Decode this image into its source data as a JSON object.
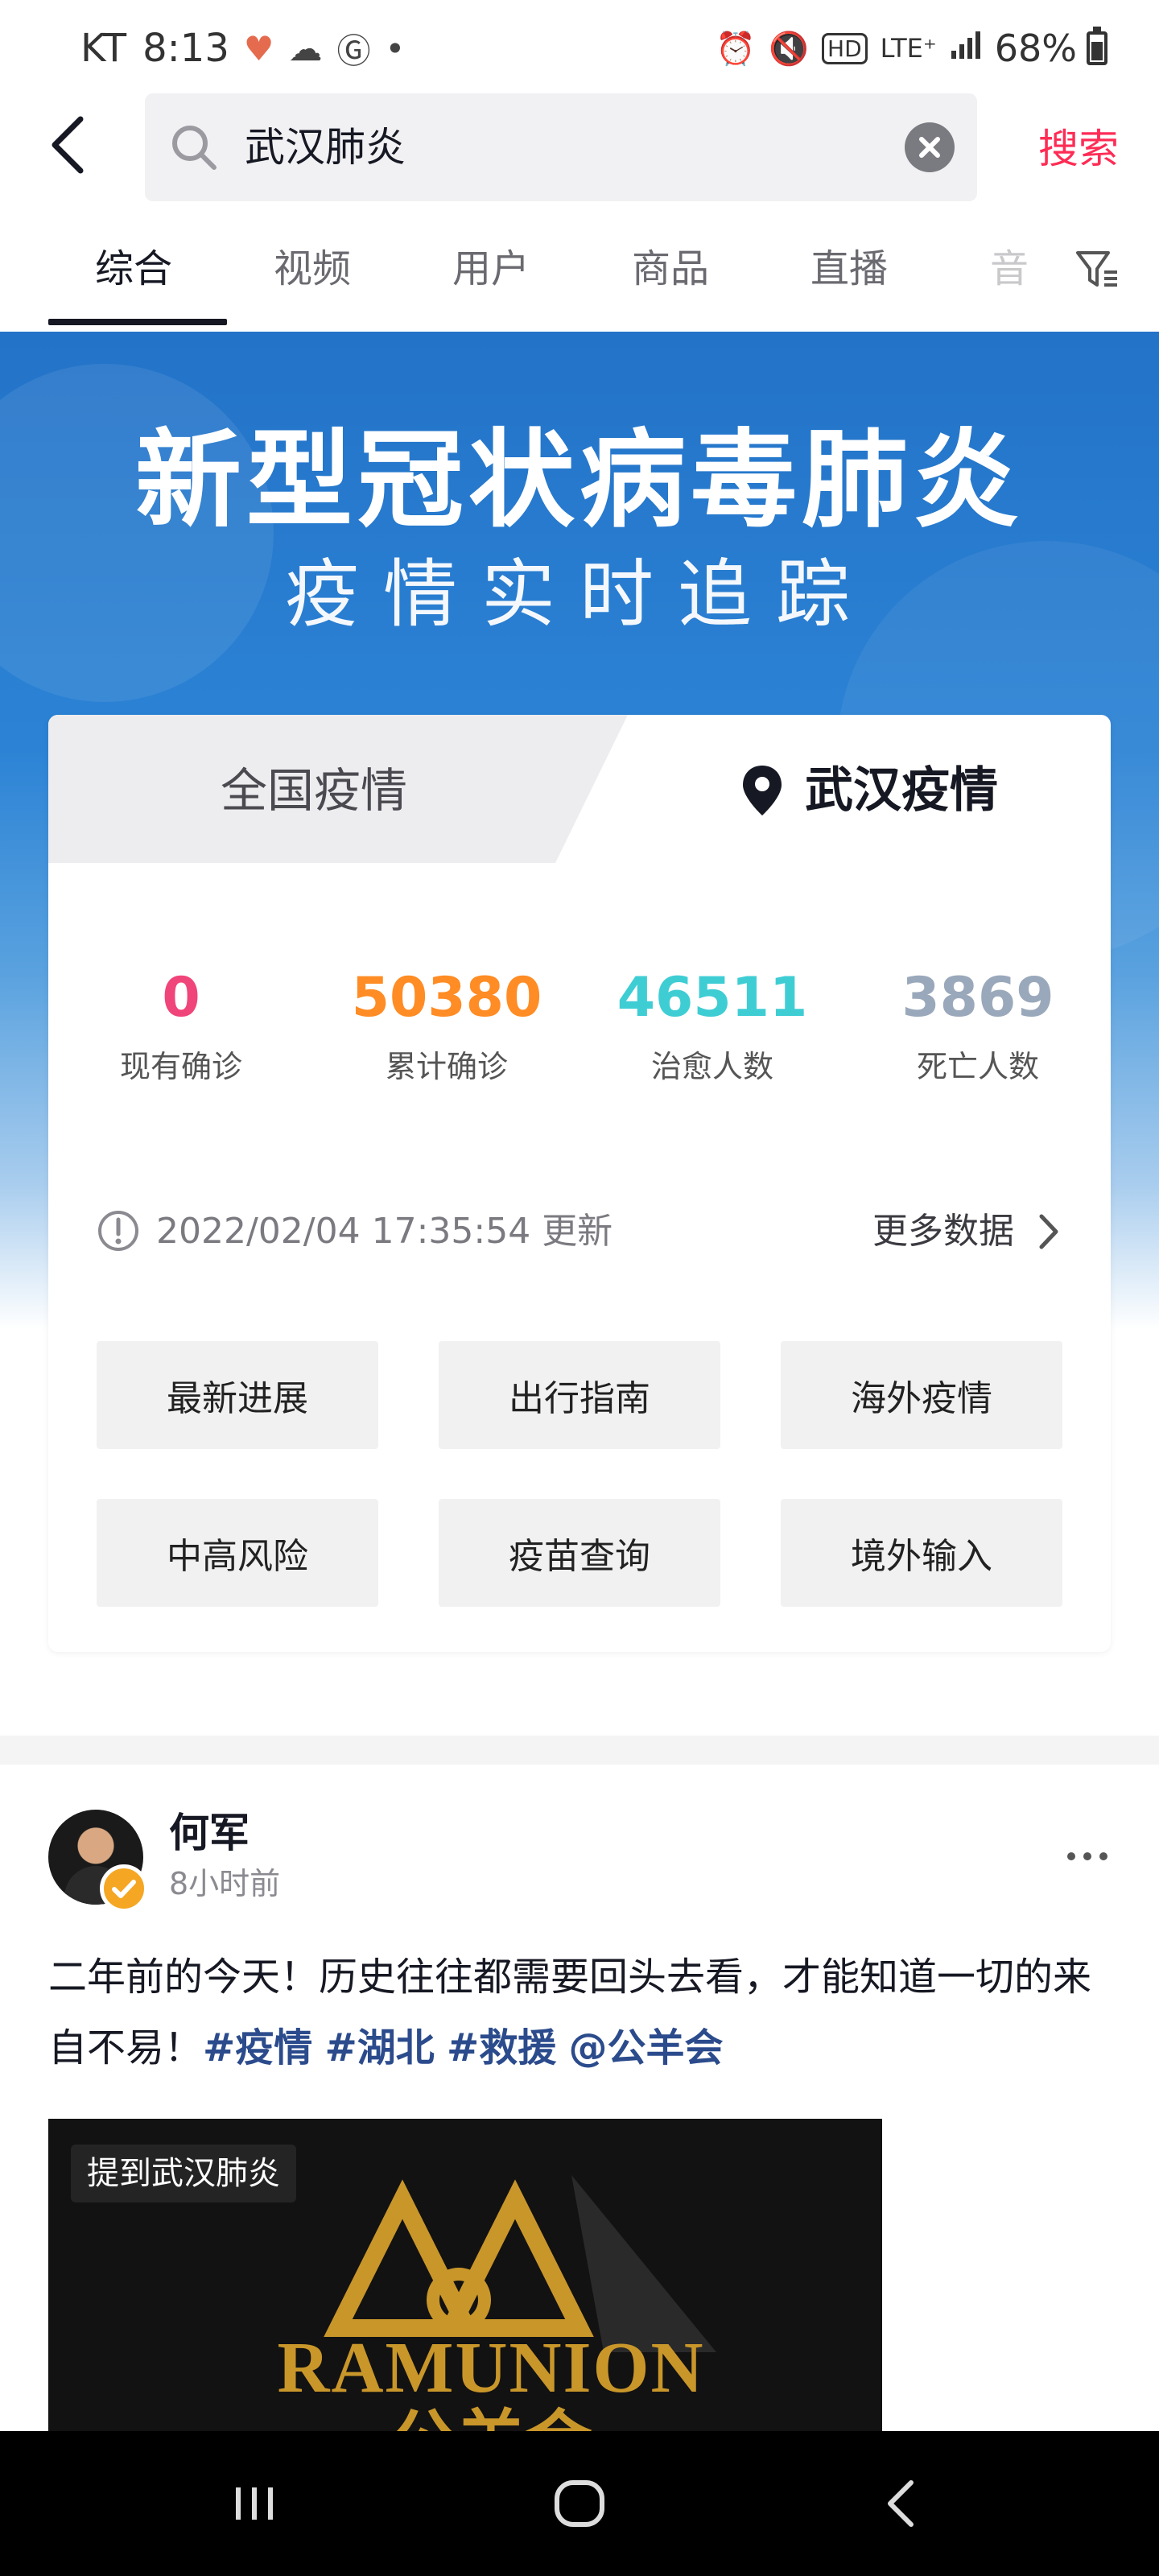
{
  "status_bar": {
    "carrier": "KT",
    "time": "8:13",
    "left_icons": [
      "heart-pulse-icon",
      "cloud-icon",
      "g-icon",
      "dot-icon"
    ],
    "right_icons": [
      "alarm-icon",
      "mute-icon",
      "hd-icon",
      "lte-icon",
      "signal-icon"
    ],
    "hd_label": "HD",
    "lte_label": "LTE⁺",
    "battery": "68%",
    "battery_level": 0.68
  },
  "header": {
    "search_query": "武汉肺炎",
    "search_button": "搜索"
  },
  "tabs": [
    "综合",
    "视频",
    "用户",
    "商品",
    "直播",
    "音"
  ],
  "active_tab": 0,
  "banner": {
    "title": "新型冠状病毒肺炎",
    "subtitle": "疫情实时追踪"
  },
  "card": {
    "tab_national": "全国疫情",
    "tab_wuhan": "武汉疫情",
    "stats": [
      {
        "value": "0",
        "label": "现有确诊",
        "color": "#f0457a"
      },
      {
        "value": "50380",
        "label": "累计确诊",
        "color": "#ff8c24"
      },
      {
        "value": "46511",
        "label": "治愈人数",
        "color": "#3fcdd4"
      },
      {
        "value": "3869",
        "label": "死亡人数",
        "color": "#9aa8bb"
      }
    ],
    "update_time": "2022/02/04 17:35:54 更新",
    "more_data": "更多数据",
    "buttons": [
      "最新进展",
      "出行指南",
      "海外疫情",
      "中高风险",
      "疫苗查询",
      "境外输入"
    ]
  },
  "post": {
    "author": "何军",
    "time": "8小时前",
    "text": "二年前的今天！历史往往都需要回头去看，才能知道一切的来自不易！",
    "tags": [
      "#疫情",
      "#湖北",
      "#救援",
      "@公羊会"
    ],
    "media_label": "提到武汉肺炎",
    "logo_text": "RAMUNION",
    "logo_text_cn": "公羊会"
  },
  "colors": {
    "accent": "#fe2c55",
    "tag": "#2b4b8c",
    "banner_blue": "#2c83d5",
    "logo_gold": "#c9962a"
  }
}
